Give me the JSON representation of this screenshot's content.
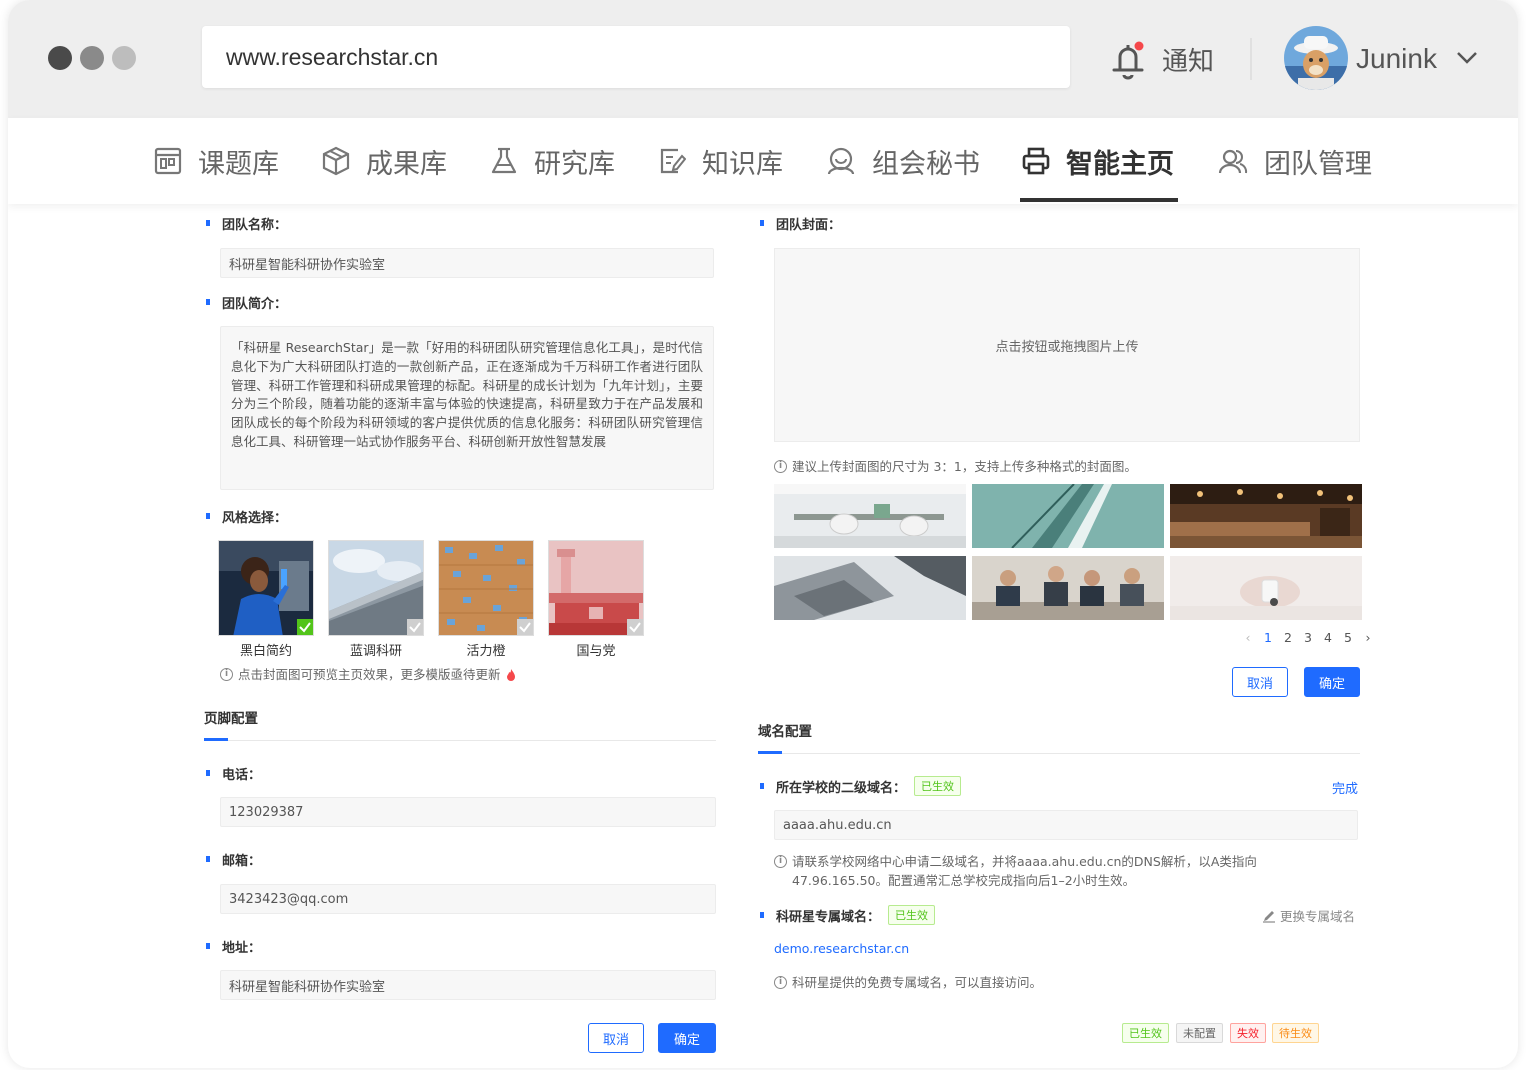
{
  "browser": {
    "url": "www.researchstar.cn",
    "notify_label": "通知",
    "username": "Junink",
    "dot_colors": [
      "#4a4a4a",
      "#8a8a8a",
      "#bdbdbd"
    ]
  },
  "nav": {
    "items": [
      {
        "label": "课题库",
        "icon": "board-icon"
      },
      {
        "label": "成果库",
        "icon": "cube-icon"
      },
      {
        "label": "研究库",
        "icon": "flask-icon"
      },
      {
        "label": "知识库",
        "icon": "note-edit-icon"
      },
      {
        "label": "组会秘书",
        "icon": "assistant-icon"
      },
      {
        "label": "智能主页",
        "icon": "printer-icon",
        "active": true
      },
      {
        "label": "团队管理",
        "icon": "team-icon"
      }
    ]
  },
  "team": {
    "name_label": "团队名称：",
    "name_value": "科研星智能科研协作实验室",
    "intro_label": "团队简介：",
    "intro_value": "「科研星 ResearchStar」是一款「好用的科研团队研究管理信息化工具」，是时代信息化下为广大科研团队打造的一款创新产品，正在逐渐成为千万科研工作者进行团队管理、科研工作管理和科研成果管理的标配。科研星的成长计划为「九年计划」，主要分为三个阶段，随着功能的逐渐丰富与体验的快速提高，科研星致力于在产品发展和团队成长的每个阶段为科研领域的客户提供优质的信息化服务：科研团队研究管理信息化工具、科研管理一站式协作服务平台、科研创新开放性智慧发展",
    "style_label": "风格选择：",
    "styles": [
      "黑白简约",
      "蓝调科研",
      "活力橙",
      "国与党"
    ],
    "style_hint": "点击封面图可预览主页效果，更多模版亟待更新"
  },
  "footer_config": {
    "title": "页脚配置",
    "phone_label": "电话：",
    "phone_value": "123029387",
    "email_label": "邮箱：",
    "email_value": "3423423@qq.com",
    "address_label": "地址：",
    "address_value": "科研星智能科研协作实验室",
    "cancel": "取消",
    "ok": "确定"
  },
  "cover": {
    "label": "团队封面：",
    "upload_text": "点击按钮或拖拽图片上传",
    "hint": "建议上传封面图的尺寸为 3：1，支持上传多种格式的封面图。",
    "pages": [
      "1",
      "2",
      "3",
      "4",
      "5"
    ],
    "prev": "‹",
    "next": "›",
    "cancel": "取消",
    "ok": "确定"
  },
  "domain": {
    "title": "域名配置",
    "school_label": "所在学校的二级域名：",
    "school_status": "已生效",
    "school_action": "完成",
    "school_value": "aaaa.ahu.edu.cn",
    "school_hint": "请联系学校网络中心申请二级域名，并将aaaa.ahu.edu.cn的DNS解析，以A类指向47.96.165.50。配置通常汇总学校完成指向后1–2小时生效。",
    "star_label": "科研星专属域名：",
    "star_status": "已生效",
    "star_action": "更换专属域名",
    "star_value": "demo.researchstar.cn",
    "star_hint": "科研星提供的免费专属域名，可以直接访问。",
    "legend": [
      "已生效",
      "未配置",
      "失效",
      "待生效"
    ]
  },
  "colors": {
    "accent": "#1f6bff",
    "green": "#52c41a",
    "red": "#f5222d",
    "orange": "#fa8c16"
  }
}
